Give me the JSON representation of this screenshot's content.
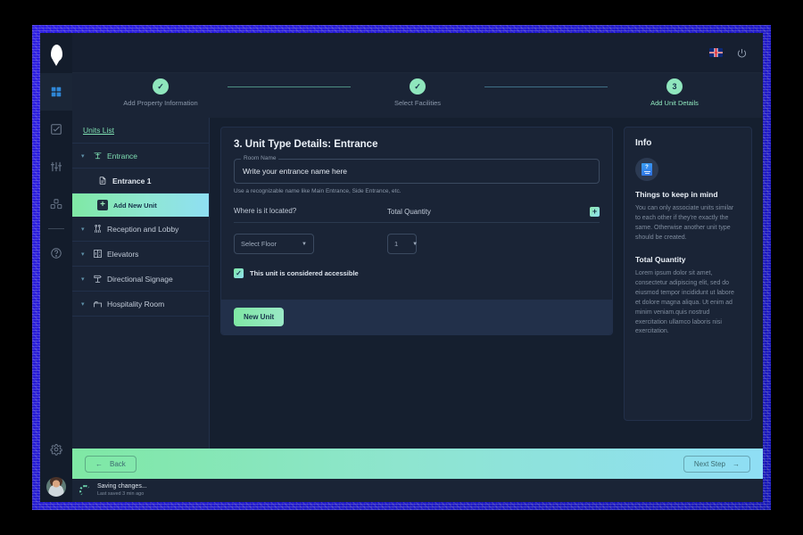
{
  "window": {
    "logo_icon": "map-pin-icon",
    "flag_icon": "uk-flag-icon",
    "power_icon": "power-icon"
  },
  "rail": {
    "items": [
      {
        "name": "dashboard",
        "icon": "grid-icon",
        "active": true
      },
      {
        "name": "tasks",
        "icon": "checkbox-edit-icon",
        "active": false
      },
      {
        "name": "settings-sliders",
        "icon": "sliders-icon",
        "active": false
      },
      {
        "name": "modules",
        "icon": "cubes-icon",
        "active": false
      },
      {
        "name": "help",
        "icon": "help-circle-icon",
        "active": false
      }
    ],
    "gear_icon": "gear-icon",
    "avatar": "user-avatar"
  },
  "stepper": {
    "steps": [
      {
        "marker": "✓",
        "label": "Add Property Information",
        "state": "done"
      },
      {
        "marker": "✓",
        "label": "Select Facilities",
        "state": "done"
      },
      {
        "marker": "3",
        "label": "Add Unit Details",
        "state": "current"
      }
    ]
  },
  "units_list": {
    "header": "Units List",
    "items": [
      {
        "label": "Entrance",
        "icon": "entrance-icon",
        "expanded": true,
        "active": true
      },
      {
        "label": "Reception and Lobby",
        "icon": "reception-icon",
        "expanded": false,
        "active": false
      },
      {
        "label": "Elevators",
        "icon": "elevator-icon",
        "expanded": false,
        "active": false
      },
      {
        "label": "Directional Signage",
        "icon": "signage-icon",
        "expanded": false,
        "active": false
      },
      {
        "label": "Hospitality Room",
        "icon": "bed-icon",
        "expanded": false,
        "active": false
      }
    ],
    "child": {
      "label": "Entrance 1",
      "icon": "document-icon"
    },
    "add_new": {
      "label": "Add New Unit",
      "icon": "plus-icon"
    }
  },
  "form": {
    "title": "3. Unit Type Details: Entrance",
    "room_name": {
      "label": "Room Name",
      "value": "Write your entrance name here",
      "placeholder": "Write your entrance name here",
      "helper": "Use a recognizable name like Main Entrance, Side Entrance, etc."
    },
    "located_label": "Where is it located?",
    "quantity_label": "Total Quantity",
    "add_row_icon": "plus-icon",
    "floor_select": {
      "value": "Select Floor",
      "caret": "▼"
    },
    "qty_select": {
      "value": "1",
      "caret": "▼"
    },
    "accessible": {
      "label": "This unit is considered accessible",
      "checked": true,
      "check_glyph": "✓"
    },
    "new_unit_button": "New Unit"
  },
  "info": {
    "title": "Info",
    "icon": "info-booklet-icon",
    "icon_glyph": "?",
    "heading_1": "Things to keep in mind",
    "body_1": "You can only associate units similar to each other if they're exactly the same. Otherwise another unit type should be created.",
    "heading_2": "Total Quantity",
    "body_2": "Lorem ipsum dolor sit amet, consectetur adipiscing elit, sed do eiusmod tempor incididunt ut labore et dolore magna aliqua. Ut enim ad minim veniam.quis nostrud exercitation ullamco laboris nisi exercitation."
  },
  "footer": {
    "back_label": "Back",
    "back_icon": "arrow-left-icon",
    "next_label": "Next Step",
    "next_icon": "arrow-right-icon"
  },
  "status": {
    "spinner_icon": "loading-spinner-icon",
    "primary": "Saving changes...",
    "secondary": "Last saved 3 min ago"
  },
  "colors": {
    "accent_green": "#7fe8a4",
    "accent_cyan": "#8fdff3",
    "panel": "#1a2436",
    "canvas": "#151f2f",
    "rail": "#131c2b",
    "frame_blue": "#1d1ae0",
    "active_blue": "#2f86d6"
  }
}
